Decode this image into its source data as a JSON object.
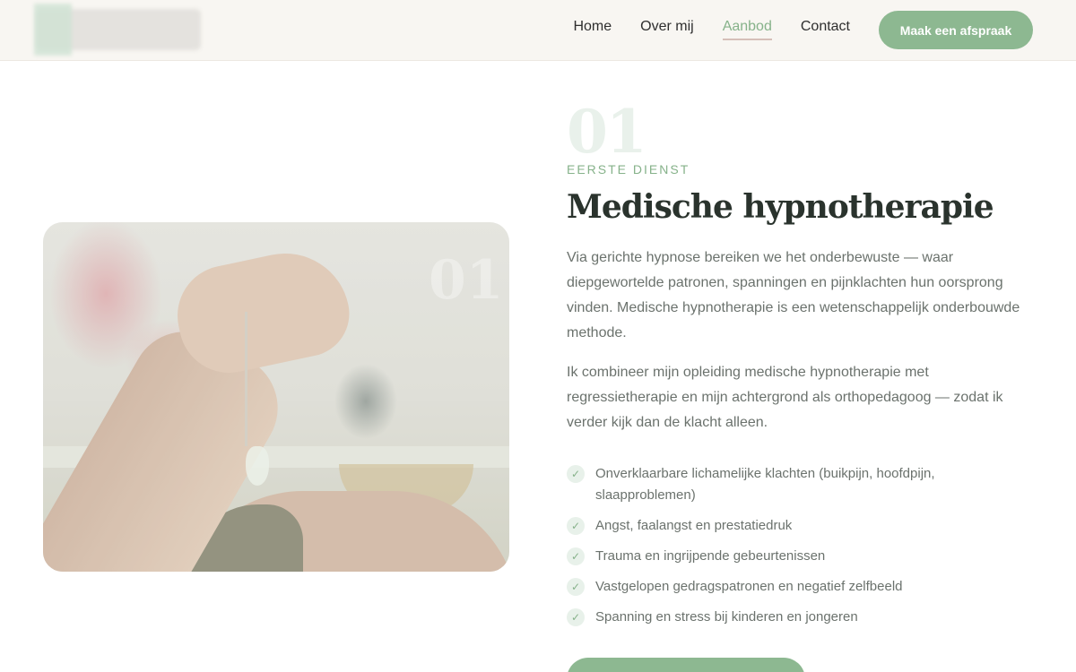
{
  "nav": {
    "items": [
      {
        "label": "Home",
        "active": false
      },
      {
        "label": "Over mij",
        "active": false
      },
      {
        "label": "Aanbod",
        "active": true
      },
      {
        "label": "Contact",
        "active": false
      }
    ],
    "cta_label": "Maak een afspraak"
  },
  "service": {
    "number": "01",
    "eyebrow": "EERSTE DIENST",
    "title": "Medische hypnotherapie",
    "paragraphs": [
      "Via gerichte hypnose bereiken we het onderbewuste — waar diepgewortelde patronen, spanningen en pijnklachten hun oorsprong vinden. Medische hypnotherapie is een wetenschappelijk onderbouwde methode.",
      "Ik combineer mijn opleiding medische hypnotherapie met regressietherapie en mijn achtergrond als orthopedagoog — zodat ik verder kijk dan de klacht alleen."
    ],
    "features": [
      "Onverklaarbare lichamelijke klachten (buikpijn, hoofdpijn, slaapproblemen)",
      "Angst, faalangst en prestatiedruk",
      "Trauma en ingrijpende gebeurtenissen",
      "Vastgelopen gedragspatronen en negatief zelfbeeld",
      "Spanning en stress bij kinderen en jongeren"
    ],
    "image_watermark": "01"
  },
  "colors": {
    "accent": "#8db891",
    "accent_text": "#86b28a",
    "header_bg": "#f8f6f2",
    "heading": "#2a332d",
    "body_text": "#6b726d"
  },
  "icons": {
    "feature_check": "check-icon"
  }
}
